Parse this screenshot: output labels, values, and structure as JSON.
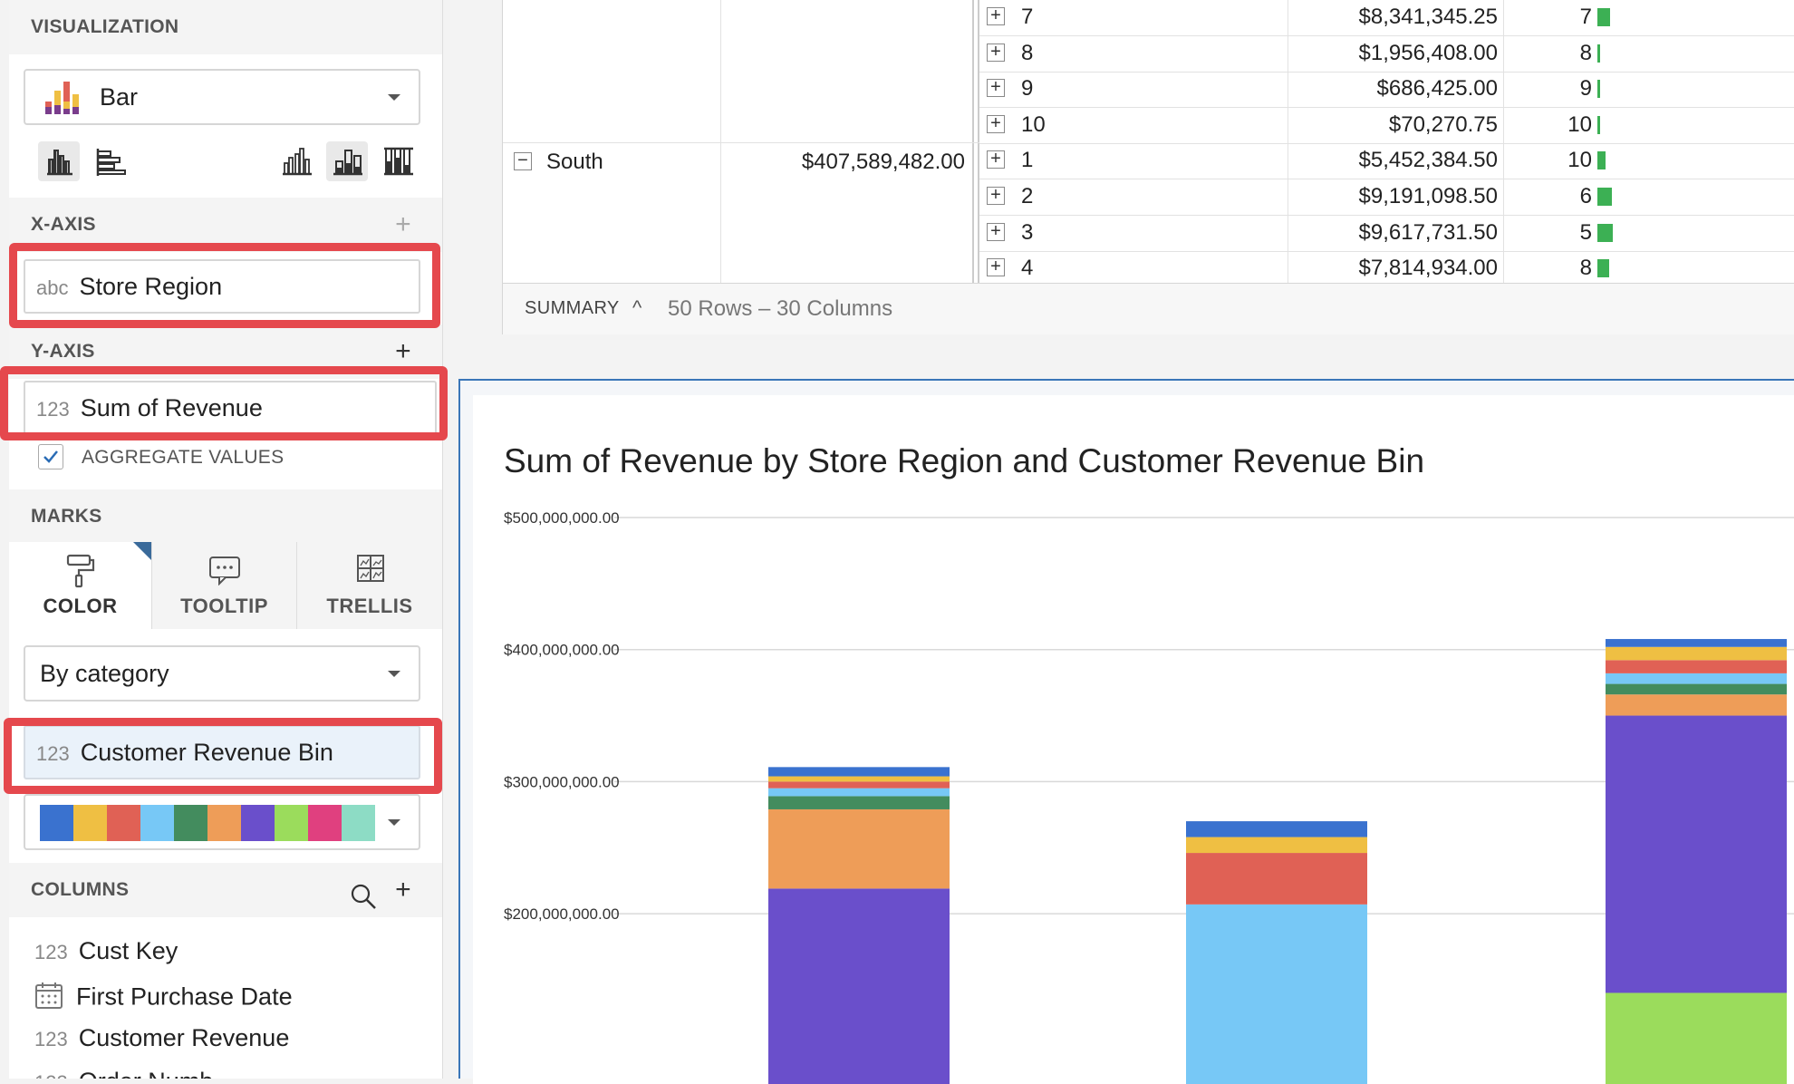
{
  "left_panel": {
    "visualization": {
      "heading": "VISUALIZATION",
      "chart_type": "Bar",
      "orientation_icons": [
        "vertical-bars-icon",
        "horizontal-bars-icon"
      ],
      "stack_icons": [
        "grouped-bars-icon",
        "stacked-bars-icon",
        "full-stacked-bars-icon"
      ]
    },
    "x_axis": {
      "heading": "X-AXIS",
      "plus": "+",
      "field_type": "abc",
      "field": "Store Region"
    },
    "y_axis": {
      "heading": "Y-AXIS",
      "plus": "+",
      "field_type": "123",
      "field": "Sum of Revenue",
      "aggregate_label": "AGGREGATE VALUES",
      "aggregate_checked": true
    },
    "marks": {
      "heading": "MARKS",
      "tabs": [
        {
          "label": "COLOR",
          "icon": "paint-roller-icon"
        },
        {
          "label": "TOOLTIP",
          "icon": "speech-bubble-icon"
        },
        {
          "label": "TRELLIS",
          "icon": "trellis-grid-icon"
        }
      ],
      "color_mode": "By category",
      "color_field_type": "123",
      "color_field": "Customer Revenue Bin",
      "palette": [
        "#3a72cf",
        "#efbf43",
        "#e06155",
        "#77c8f6",
        "#438c5e",
        "#ee9d58",
        "#6a4fcb",
        "#9bdc5c",
        "#e0407f",
        "#8ddcc5"
      ]
    },
    "columns": {
      "heading": "COLUMNS",
      "plus": "+",
      "items": [
        {
          "type": "123",
          "label": "Cust Key"
        },
        {
          "type": "calendar",
          "label": "First Purchase Date"
        },
        {
          "type": "123",
          "label": "Customer Revenue"
        },
        {
          "type": "123",
          "label": "Order Numb"
        }
      ]
    }
  },
  "table": {
    "rows": [
      {
        "bin": "7",
        "revenue": "$8,341,345.25",
        "rank": "7",
        "bar": 0.65
      },
      {
        "bin": "8",
        "revenue": "$1,956,408.00",
        "rank": "8",
        "bar": 0.15
      },
      {
        "bin": "9",
        "revenue": "$686,425.00",
        "rank": "9",
        "bar": 0.05
      },
      {
        "bin": "10",
        "revenue": "$70,270.75",
        "rank": "10",
        "bar": 0.02
      },
      {
        "bin": "1",
        "revenue": "$5,452,384.50",
        "rank": "10",
        "bar": 0.42
      },
      {
        "bin": "2",
        "revenue": "$9,191,098.50",
        "rank": "6",
        "bar": 0.72
      },
      {
        "bin": "3",
        "revenue": "$9,617,731.50",
        "rank": "5",
        "bar": 0.75
      },
      {
        "bin": "4",
        "revenue": "$7,814,934.00",
        "rank": "8",
        "bar": 0.6
      }
    ],
    "group": {
      "expander": "−",
      "region": "South",
      "total": "$407,589,482.00"
    },
    "summary": {
      "label": "SUMMARY",
      "caret": "^",
      "counts": "50 Rows – 30 Columns"
    }
  },
  "chart_data": {
    "type": "bar",
    "stacked": true,
    "title": "Sum of Revenue by Store Region and Customer Revenue Bin",
    "y_ticks": [
      "$500,000,000.00",
      "$400,000,000.00",
      "$300,000,000.00",
      "$200,000,000.00"
    ],
    "ylim_visible": [
      135000000,
      520000000
    ],
    "grid": true,
    "stacks": [
      {
        "segments": [
          {
            "color": "#6a4fcb",
            "from": 0,
            "to": 219000000
          },
          {
            "color": "#ee9d58",
            "from": 219000000,
            "to": 279000000
          },
          {
            "color": "#438c5e",
            "from": 279000000,
            "to": 289000000
          },
          {
            "color": "#77c8f6",
            "from": 289000000,
            "to": 295000000
          },
          {
            "color": "#e06155",
            "from": 295000000,
            "to": 300000000
          },
          {
            "color": "#efbf43",
            "from": 300000000,
            "to": 304000000
          },
          {
            "color": "#3a72cf",
            "from": 304000000,
            "to": 311000000
          }
        ]
      },
      {
        "segments": [
          {
            "color": "#77c8f6",
            "from": 0,
            "to": 207000000
          },
          {
            "color": "#e06155",
            "from": 207000000,
            "to": 246000000
          },
          {
            "color": "#efbf43",
            "from": 246000000,
            "to": 258000000
          },
          {
            "color": "#3a72cf",
            "from": 258000000,
            "to": 270000000
          }
        ]
      },
      {
        "segments": [
          {
            "color": "#9bdc5c",
            "from": 0,
            "to": 140000000
          },
          {
            "color": "#6a4fcb",
            "from": 140000000,
            "to": 350000000
          },
          {
            "color": "#ee9d58",
            "from": 350000000,
            "to": 366000000
          },
          {
            "color": "#438c5e",
            "from": 366000000,
            "to": 374000000
          },
          {
            "color": "#77c8f6",
            "from": 374000000,
            "to": 382000000
          },
          {
            "color": "#e06155",
            "from": 382000000,
            "to": 392000000
          },
          {
            "color": "#efbf43",
            "from": 392000000,
            "to": 402000000
          },
          {
            "color": "#3a72cf",
            "from": 402000000,
            "to": 408000000
          }
        ]
      }
    ]
  }
}
